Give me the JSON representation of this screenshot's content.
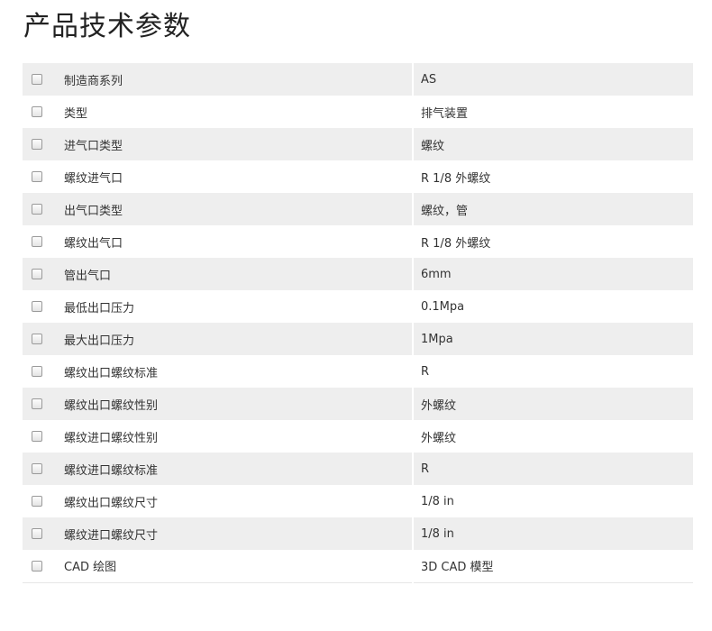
{
  "page_title": "产品技术参数",
  "specs": [
    {
      "name": "制造商系列",
      "value": "AS"
    },
    {
      "name": "类型",
      "value": "排气装置"
    },
    {
      "name": "进气口类型",
      "value": "螺纹"
    },
    {
      "name": "螺纹进气口",
      "value": "R 1/8 外螺纹"
    },
    {
      "name": "出气口类型",
      "value": "螺纹，管"
    },
    {
      "name": "螺纹出气口",
      "value": "R 1/8 外螺纹"
    },
    {
      "name": "管出气口",
      "value": "6mm"
    },
    {
      "name": "最低出口压力",
      "value": "0.1Mpa"
    },
    {
      "name": "最大出口压力",
      "value": "1Mpa"
    },
    {
      "name": "螺纹出口螺纹标准",
      "value": "R"
    },
    {
      "name": "螺纹出口螺纹性别",
      "value": "外螺纹"
    },
    {
      "name": "螺纹进口螺纹性别",
      "value": "外螺纹"
    },
    {
      "name": "螺纹进口螺纹标准",
      "value": "R"
    },
    {
      "name": "螺纹出口螺纹尺寸",
      "value": "1/8 in"
    },
    {
      "name": "螺纹进口螺纹尺寸",
      "value": "1/8 in"
    },
    {
      "name": "CAD 绘图",
      "value": "3D CAD 模型"
    }
  ]
}
